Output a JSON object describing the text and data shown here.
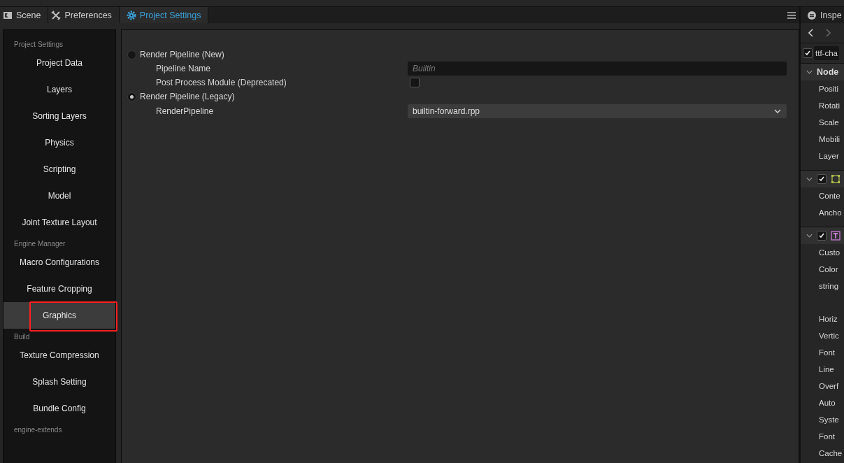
{
  "tabs": [
    {
      "label": "Scene",
      "kind": "scene",
      "selected": false
    },
    {
      "label": "Preferences",
      "kind": "tools",
      "selected": false
    },
    {
      "label": "Project Settings",
      "kind": "gear",
      "selected": true
    }
  ],
  "sidebar": {
    "sections": [
      {
        "title": "Project Settings",
        "items": [
          {
            "label": "Project Data",
            "selected": false,
            "highlighted": false
          },
          {
            "label": "Layers",
            "selected": false,
            "highlighted": false
          },
          {
            "label": "Sorting Layers",
            "selected": false,
            "highlighted": false
          },
          {
            "label": "Physics",
            "selected": false,
            "highlighted": false
          },
          {
            "label": "Scripting",
            "selected": false,
            "highlighted": false
          },
          {
            "label": "Model",
            "selected": false,
            "highlighted": false
          },
          {
            "label": "Joint Texture Layout",
            "selected": false,
            "highlighted": false
          }
        ]
      },
      {
        "title": "Engine Manager",
        "items": [
          {
            "label": "Macro Configurations",
            "selected": false,
            "highlighted": false
          },
          {
            "label": "Feature Cropping",
            "selected": false,
            "highlighted": false
          },
          {
            "label": "Graphics",
            "selected": true,
            "highlighted": true
          }
        ]
      },
      {
        "title": "Build",
        "items": [
          {
            "label": "Texture Compression",
            "selected": false,
            "highlighted": false
          },
          {
            "label": "Splash Setting",
            "selected": false,
            "highlighted": false
          },
          {
            "label": "Bundle Config",
            "selected": false,
            "highlighted": false
          }
        ]
      },
      {
        "title": "engine-extends"
      }
    ]
  },
  "settings": {
    "rows": [
      {
        "kind": "radio",
        "label": "Render Pipeline (New)",
        "selected": false
      },
      {
        "kind": "text",
        "label": "Pipeline Name",
        "placeholder": "Builtin"
      },
      {
        "kind": "checkbox",
        "label": "Post Process Module (Deprecated)",
        "checked": false
      },
      {
        "kind": "radio",
        "label": "Render Pipeline (Legacy)",
        "selected": true
      },
      {
        "kind": "select",
        "label": "RenderPipeline",
        "value": "builtin-forward.rpp"
      }
    ]
  },
  "inspector": {
    "title": "Inspe",
    "node": {
      "name": "ttf-cha",
      "enabled": true
    },
    "components": [
      {
        "kind": "node",
        "title": "Node",
        "expanded": true,
        "props": [
          {
            "label": "Positi",
            "kind": "line"
          },
          {
            "label": "Rotati",
            "kind": "line"
          },
          {
            "label": "Scale",
            "kind": "line"
          },
          {
            "label": "Mobili",
            "kind": "line"
          },
          {
            "label": "Layer",
            "kind": "line"
          }
        ]
      },
      {
        "kind": "transform",
        "enabled": true,
        "expanded": true,
        "props": [
          {
            "label": "Conte",
            "kind": "line"
          },
          {
            "label": "Ancho",
            "kind": "line"
          }
        ]
      },
      {
        "kind": "label",
        "enabled": true,
        "expanded": true,
        "props": [
          {
            "label": "Custo",
            "kind": "line"
          },
          {
            "label": "Color",
            "kind": "line"
          },
          {
            "label": "string",
            "kind": "multiline"
          },
          {
            "label": "Horiz",
            "kind": "line"
          },
          {
            "label": "Vertic",
            "kind": "line"
          },
          {
            "label": "Font",
            "kind": "line"
          },
          {
            "label": "Line",
            "kind": "line"
          },
          {
            "label": "Overf",
            "kind": "line"
          },
          {
            "label": "Auto",
            "kind": "line"
          },
          {
            "label": "Syste",
            "kind": "line"
          },
          {
            "label": "Font",
            "kind": "line"
          },
          {
            "label": "Cache",
            "kind": "line"
          }
        ]
      }
    ]
  }
}
